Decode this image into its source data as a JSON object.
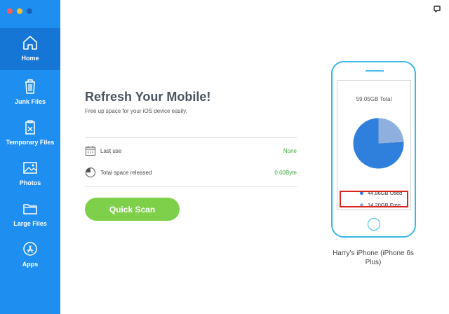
{
  "colors": {
    "sidebar": "#1f8ef1",
    "sidebar_active": "#1676d6",
    "accent_green": "#7ed04a",
    "value_green": "#3aa93a",
    "phone_outline": "#38b8e6",
    "pie_used": "#2f7fdc",
    "pie_free": "#8fb0de",
    "highlight": "#d9261c"
  },
  "sidebar": {
    "items": [
      {
        "label": "Home",
        "icon": "home-icon"
      },
      {
        "label": "Junk Files",
        "icon": "trash-icon"
      },
      {
        "label": "Temporary Files",
        "icon": "temp-files-icon"
      },
      {
        "label": "Photos",
        "icon": "photo-icon"
      },
      {
        "label": "Large Files",
        "icon": "folder-icon"
      },
      {
        "label": "Apps",
        "icon": "app-store-icon"
      }
    ]
  },
  "main": {
    "title": "Refresh Your Mobile!",
    "subtitle": "Free up space for your iOS device easily.",
    "rows": [
      {
        "label": "Last use",
        "value": "None",
        "icon": "calendar-icon"
      },
      {
        "label": "Total space released",
        "value": "0.00Byte",
        "icon": "pie-chart-icon"
      }
    ],
    "scan_label": "Quick Scan"
  },
  "device": {
    "total": "59.05GB Total",
    "used_label": "44.86GB Used",
    "free_label": "14.20GB Free",
    "used_gb": 44.86,
    "free_gb": 14.2,
    "name": "Harry's iPhone (iPhone 6s Plus)"
  }
}
